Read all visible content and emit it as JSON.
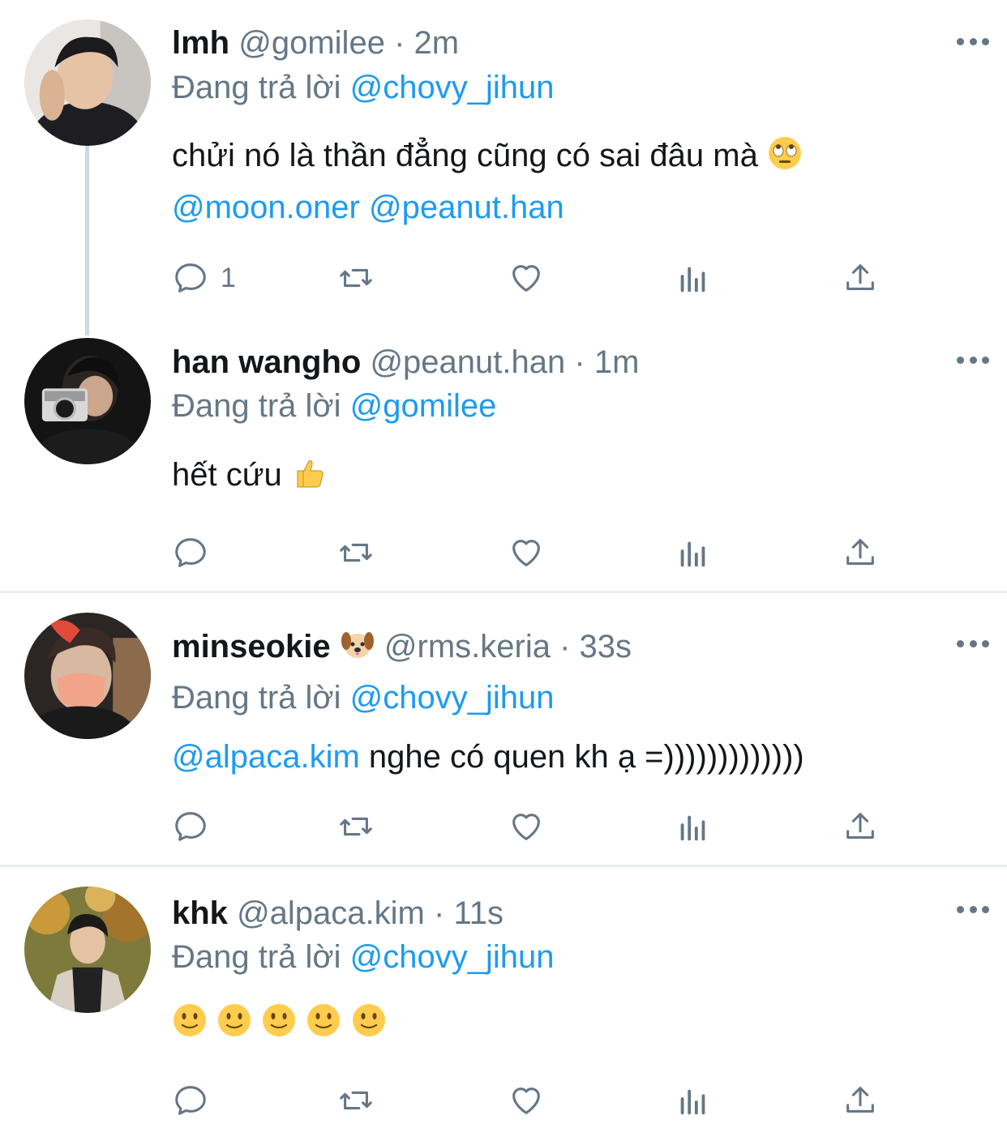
{
  "tweets": [
    {
      "name": "lmh",
      "handle": "@gomilee",
      "dot": "·",
      "time": "2m",
      "reply_prefix": "Đang trả lời",
      "reply_to": "@chovy_jihun",
      "text_line1": "chửi nó là thần đẳng cũng có sai đâu mà",
      "mention_a": "@moon.oner",
      "mention_b": "@peanut.han",
      "reply_count": "1"
    },
    {
      "name": "han wangho",
      "handle": "@peanut.han",
      "dot": "·",
      "time": "1m",
      "reply_prefix": "Đang trả lời",
      "reply_to": "@gomilee",
      "text": "hết cứu"
    },
    {
      "name": "minseokie",
      "handle": "@rms.keria",
      "dot": "·",
      "time": "33s",
      "reply_prefix": "Đang trả lời",
      "reply_to": "@chovy_jihun",
      "mention": "@alpaca.kim",
      "text": " nghe có quen kh ạ =)))))))))))))"
    },
    {
      "name": "khk",
      "handle": "@alpaca.kim",
      "dot": "·",
      "time": "11s",
      "reply_prefix": "Đang trả lời",
      "reply_to": "@chovy_jihun"
    }
  ],
  "icons": {
    "reply": "reply-icon",
    "retweet": "retweet-icon",
    "like": "heart-icon",
    "analytics": "analytics-icon",
    "share": "share-icon",
    "more": "more-icon"
  },
  "colors": {
    "mention": "#1d9bf0",
    "secondary": "#657786",
    "divider": "#e6ecf0"
  }
}
